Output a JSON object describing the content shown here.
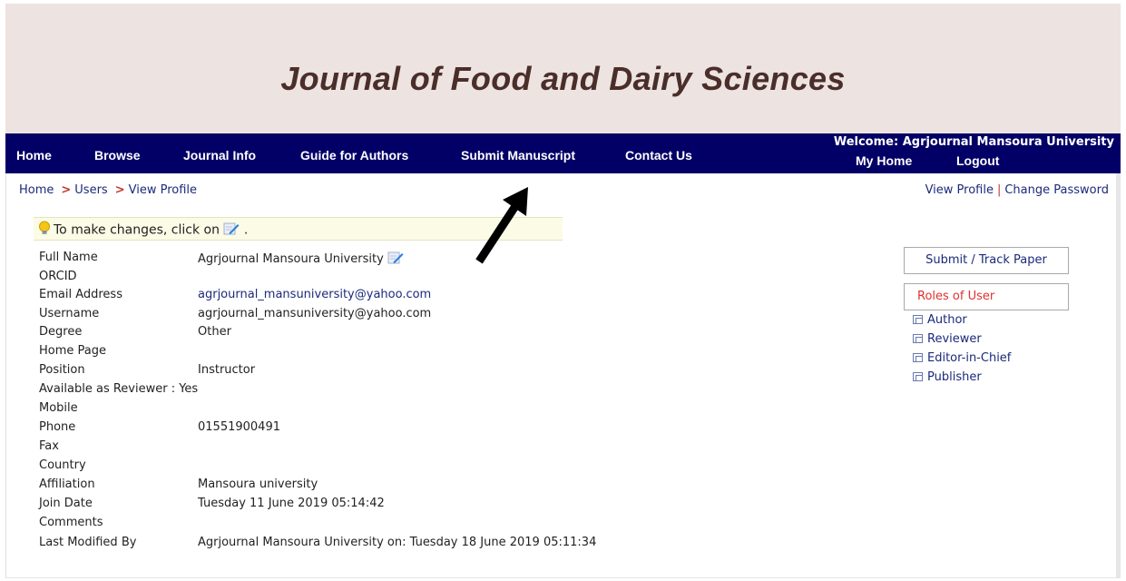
{
  "journal": {
    "title": "Journal of Food and Dairy Sciences"
  },
  "nav": {
    "items": [
      "Home",
      "Browse",
      "Journal Info",
      "Guide for Authors",
      "Submit Manuscript",
      "Contact Us"
    ],
    "welcome": "Welcome: Agrjournal Mansoura University",
    "my_home": "My Home",
    "logout": "Logout"
  },
  "breadcrumb": {
    "home": "Home",
    "sep": ">",
    "users": "Users",
    "current": "View Profile"
  },
  "top_links": {
    "view_profile": "View Profile",
    "sep": "|",
    "change_password": "Change Password"
  },
  "tip": {
    "text": "To make changes, click on",
    "end": "."
  },
  "profile": [
    {
      "label": "Full Name",
      "value": "Agrjournal Mansoura University"
    },
    {
      "label": "ORCID",
      "value": ""
    },
    {
      "label": "Email Address",
      "value": "agrjournal_mansuniversity@yahoo.com"
    },
    {
      "label": "Username",
      "value": "agrjournal_mansuniversity@yahoo.com"
    },
    {
      "label": "Degree",
      "value": "Other"
    },
    {
      "label": "Home Page",
      "value": ""
    },
    {
      "label": "Position",
      "value": "Instructor"
    },
    {
      "label": "Available as Reviewer : Yes",
      "value": ""
    },
    {
      "label": "Mobile",
      "value": ""
    },
    {
      "label": "Phone",
      "value": "01551900491"
    },
    {
      "label": "Fax",
      "value": ""
    },
    {
      "label": "Country",
      "value": ""
    },
    {
      "label": "Affiliation",
      "value": "Mansoura university"
    },
    {
      "label": "Join Date",
      "value": "Tuesday 11 June 2019 05:14:42"
    },
    {
      "label": "Comments",
      "value": ""
    },
    {
      "label": "Last Modified By",
      "value": "Agrjournal Mansoura University on: Tuesday 18 June 2019 05:11:34"
    }
  ],
  "sidebar": {
    "submit_track": "Submit / Track Paper",
    "roles_title": "Roles of User",
    "roles": [
      "Author",
      "Reviewer",
      "Editor-in-Chief",
      "Publisher"
    ]
  },
  "icons": {
    "tip": "lightbulb-icon",
    "edit": "edit-pencil-icon",
    "role": "window-icon",
    "annotation": "arrow-icon"
  },
  "colors": {
    "nav_bg": "#020066",
    "banner_bg": "#ede3e1",
    "link": "#1b2a7a",
    "accent_red": "#c0392b",
    "title": "#4a2e2a"
  }
}
